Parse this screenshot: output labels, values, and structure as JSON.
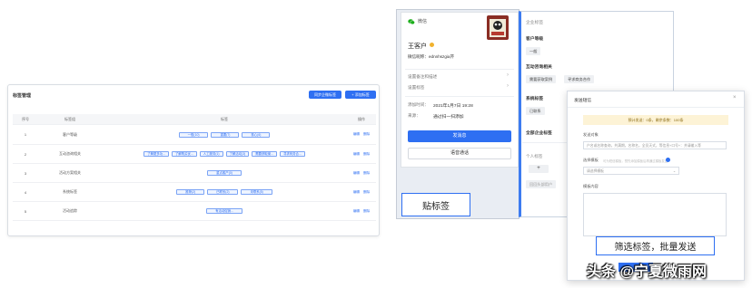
{
  "tag_manager": {
    "title": "标签管理",
    "sync_button": "同步企微标签",
    "add_button": "添加标签",
    "columns": [
      "序号",
      "标签组",
      "标签",
      "操作"
    ],
    "rows": [
      {
        "no": "1",
        "group": "客户等级",
        "tags": [
          "一般(10)",
          "重要(7)",
          "核心(6)"
        ]
      },
      {
        "no": "2",
        "group": "互动咨询相关",
        "tags": [
          "了解更多功...",
          "了解购买优...",
          "人工服务(1)",
          "了解活动(3)",
          "需要获取案...",
          "寻求商务合..."
        ]
      },
      {
        "no": "3",
        "group": "活动方案相关",
        "tags": [
          "重点客户(0)"
        ]
      },
      {
        "no": "4",
        "group": "系统标签",
        "tags": [
          "推荐(2)",
          "已联系(2)",
          "未联系(5)"
        ]
      },
      {
        "no": "5",
        "group": "活动追踪",
        "tags": [
          "有活动促销..."
        ]
      }
    ],
    "edit_label": "编辑",
    "delete_label": "删除"
  },
  "contact": {
    "source": "微信",
    "name": "王客户",
    "nickname": "微信昵称：ednnhszgia芹",
    "setting_rows": [
      "设置备注和描述",
      "设置标签"
    ],
    "add_time_label": "添加时间：",
    "add_time": "2021年1月7日 19:28",
    "source_label": "来源：",
    "source_value": "通过扫一扫添加",
    "send_button": "发消息",
    "voice_button": "语音通话"
  },
  "tag_selector": {
    "header": "企业标签",
    "groups": [
      {
        "title": "客户等级",
        "tags": [
          "一般"
        ]
      },
      {
        "title": "互动咨询相关",
        "tags": [
          "需要获取案例",
          "寻求商务合作"
        ]
      },
      {
        "title": "系统标签",
        "tags": [
          "已联系"
        ]
      }
    ],
    "all_tags": "全部企业标签",
    "personal_tags": "个人标签",
    "add_symbol": "+",
    "personal_chip": "回回头部用户"
  },
  "bulk_dialog": {
    "title": "发送短信",
    "close": "×",
    "notice": "预计发送：0条，剩余条数：100条",
    "target_label": "发送对象",
    "target_placeholder": "户名或名称查询，共满期，名称名，全员天式，等信息+口号+：并请输入等",
    "template_label": "选择模板",
    "template_hint": "可为短信模板，预先添加模板后再通过模板发送",
    "template_placeholder": "请选择模板",
    "content_label": "模板内容"
  },
  "captions": {
    "left": "贴标签",
    "right": "筛选标签，批量发送"
  },
  "watermark": "头条 @宁夏微雨网",
  "colors": {
    "primary": "#2e6ff2",
    "notice_bg": "#fdf3d6"
  }
}
